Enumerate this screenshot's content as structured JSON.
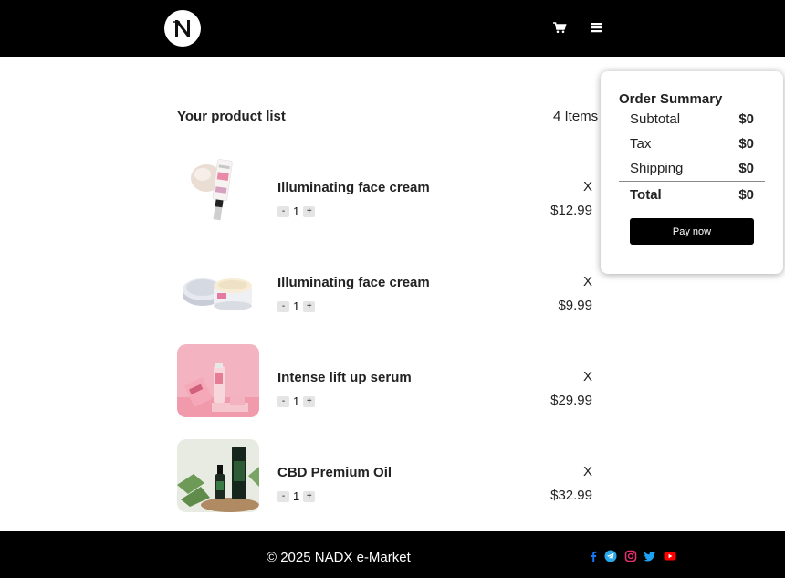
{
  "header": {
    "logo_letter": "N"
  },
  "main": {
    "list_title": "Your product list",
    "items_count": "4 Items",
    "products": [
      {
        "name": "Illuminating face cream",
        "qty": "1",
        "price": "$12.99",
        "remove_label": "X",
        "minus": "-",
        "plus": "+"
      },
      {
        "name": "Illuminating face cream",
        "qty": "1",
        "price": "$9.99",
        "remove_label": "X",
        "minus": "-",
        "plus": "+"
      },
      {
        "name": "Intense lift up serum",
        "qty": "1",
        "price": "$29.99",
        "remove_label": "X",
        "minus": "-",
        "plus": "+"
      },
      {
        "name": "CBD Premium Oil",
        "qty": "1",
        "price": "$32.99",
        "remove_label": "X",
        "minus": "-",
        "plus": "+"
      }
    ]
  },
  "summary": {
    "title": "Order Summary",
    "subtotal_label": "Subtotal",
    "subtotal_value": "$0",
    "tax_label": "Tax",
    "tax_value": "$0",
    "shipping_label": "Shipping",
    "shipping_value": "$0",
    "total_label": "Total",
    "total_value": "$0",
    "pay_button": "Pay now"
  },
  "footer": {
    "copyright": "© 2025 NADX e-Market",
    "social_icons": [
      "facebook-icon",
      "telegram-icon",
      "instagram-icon",
      "twitter-icon",
      "youtube-icon"
    ]
  },
  "colors": {
    "header_bg": "#000000",
    "footer_bg": "#000000",
    "facebook": "#1877f2",
    "telegram": "#29a9eb",
    "instagram": "#e1306c",
    "twitter": "#1da1f2",
    "youtube": "#ff0000"
  }
}
